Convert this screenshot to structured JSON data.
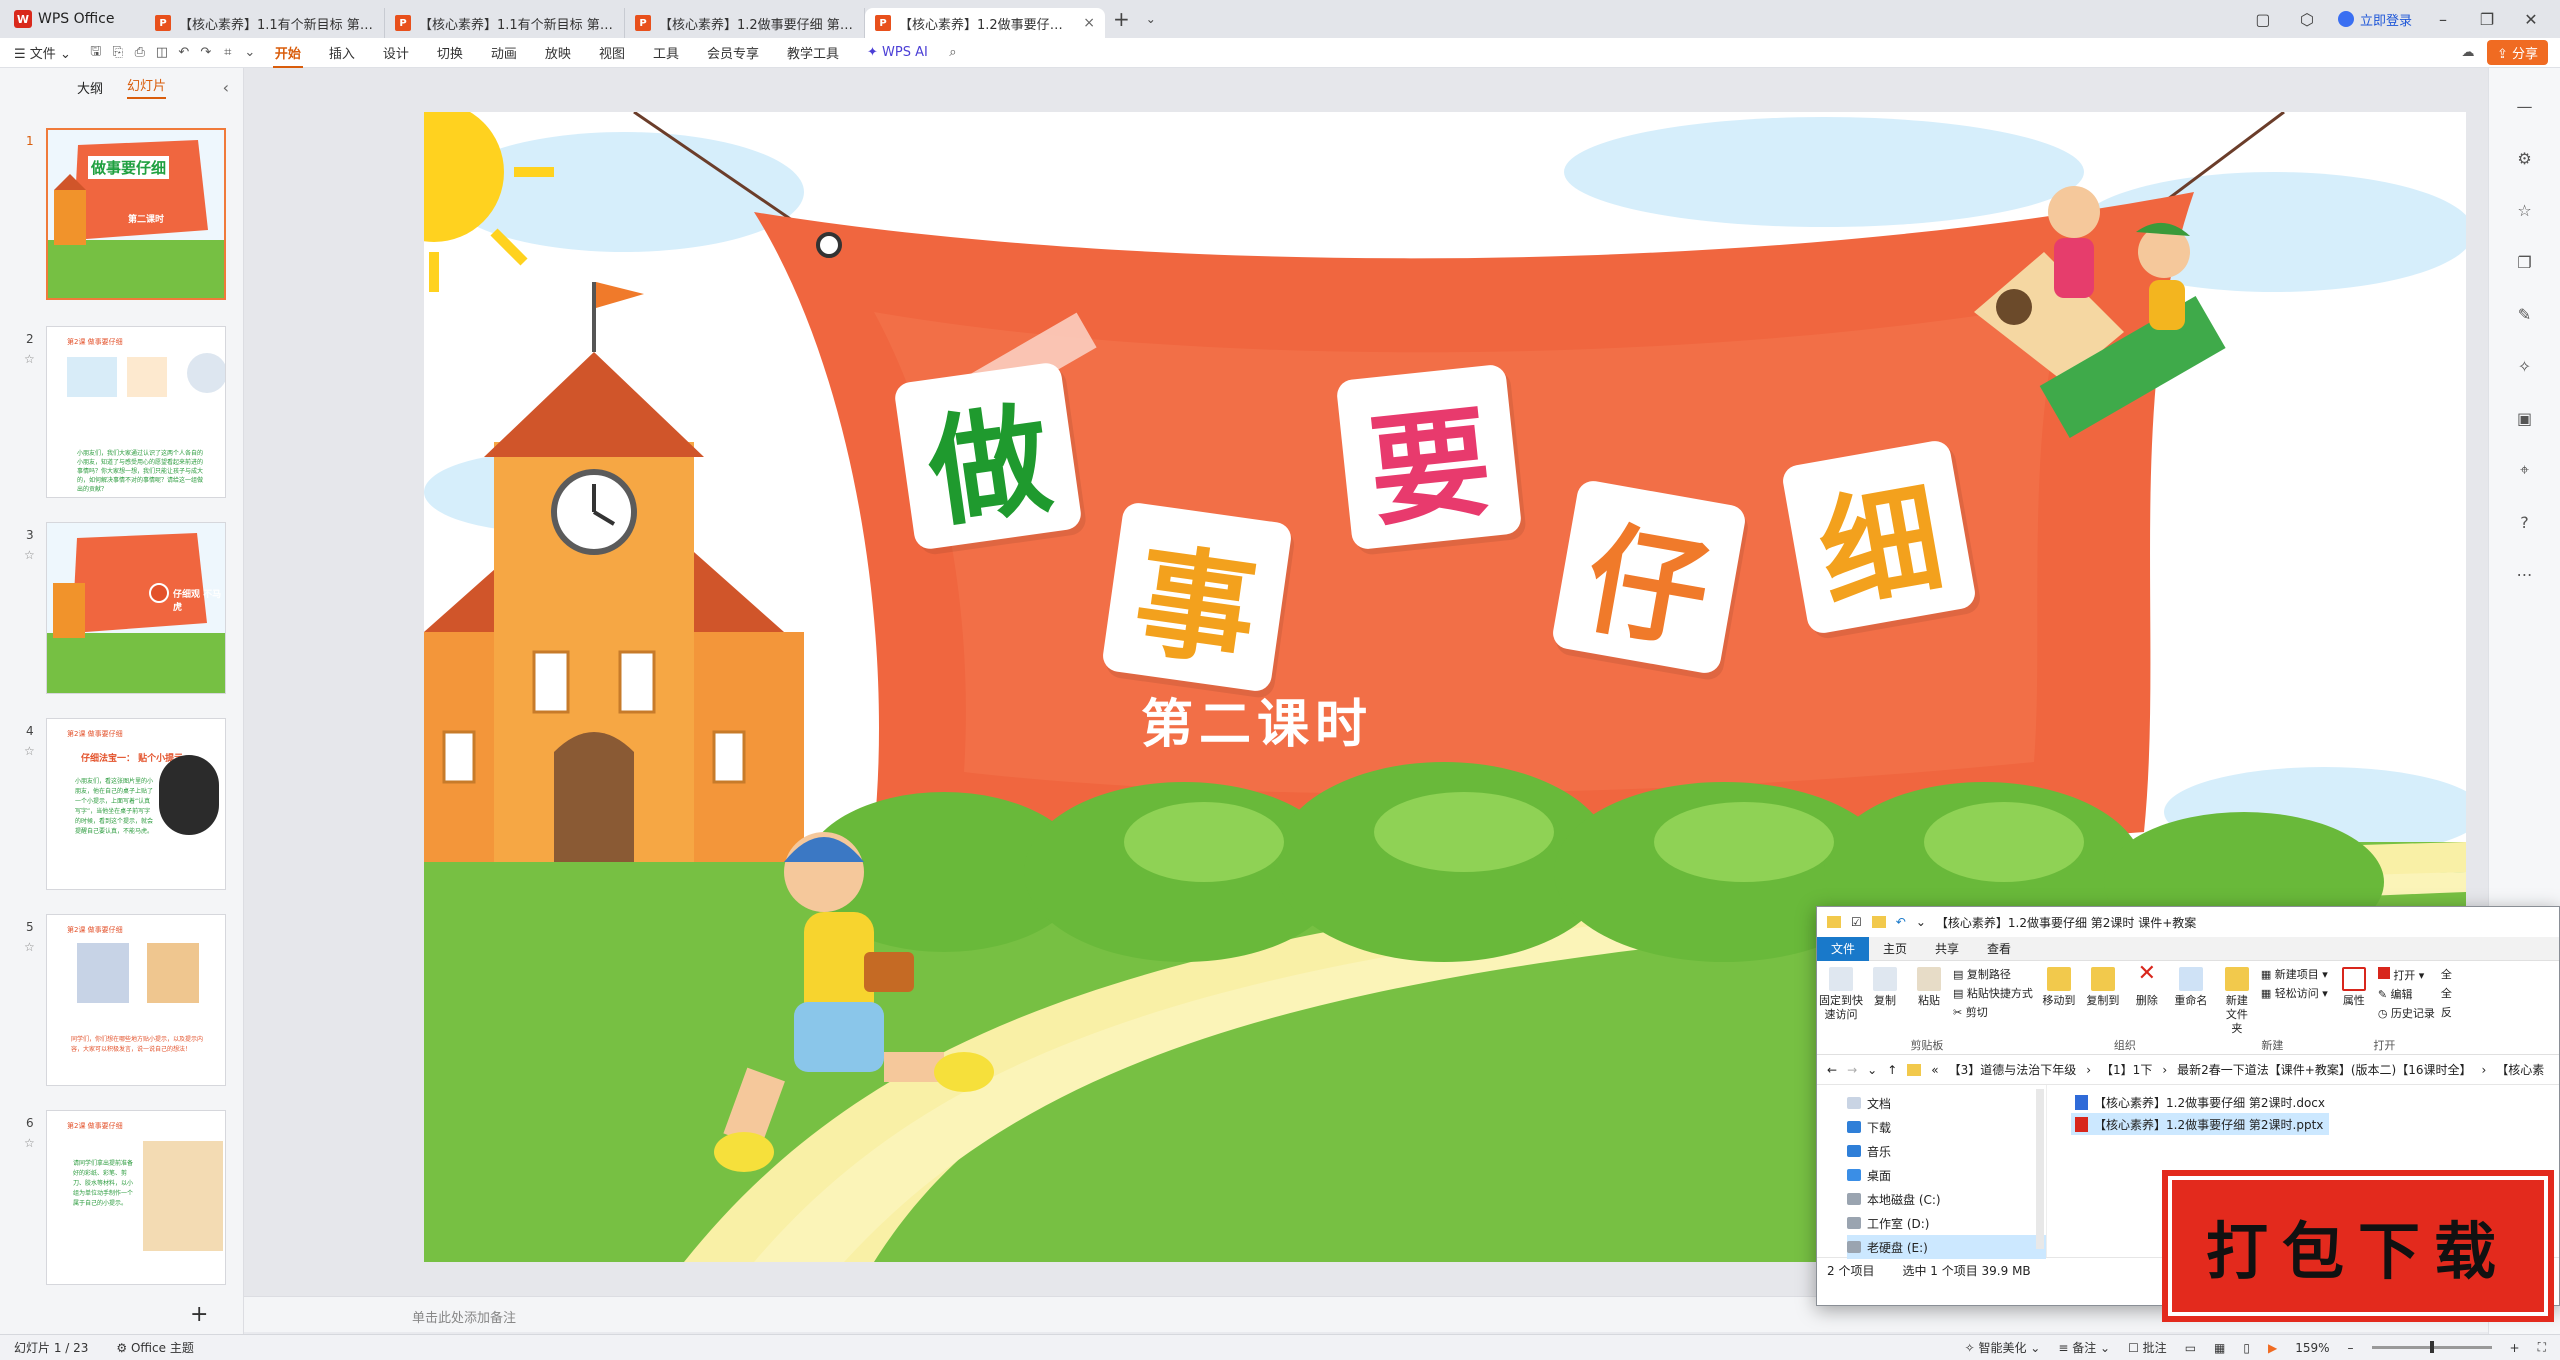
{
  "app": {
    "name": "WPS Office"
  },
  "tabs": [
    {
      "label": "【核心素养】1.1有个新目标 第1课时",
      "icon": "P"
    },
    {
      "label": "【核心素养】1.1有个新目标 第2课时",
      "icon": "P"
    },
    {
      "label": "【核心素养】1.2做事要仔细 第1课时",
      "icon": "P"
    },
    {
      "label": "【核心素养】1.2做事要仔细 第2课时",
      "icon": "P"
    }
  ],
  "header": {
    "login": "立即登录",
    "share": "分享"
  },
  "menu": {
    "file": "文件",
    "items": [
      "开始",
      "插入",
      "设计",
      "切换",
      "动画",
      "放映",
      "视图",
      "工具",
      "会员专享",
      "教学工具"
    ],
    "ai": "WPS AI",
    "active": "开始"
  },
  "left_panel": {
    "tab_outline": "大纲",
    "tab_slides": "幻灯片",
    "slides": [
      {
        "num": "1",
        "title": "做事要仔细",
        "sub": "第二课时"
      },
      {
        "num": "2",
        "header": "第2课 做事要仔细",
        "text": "小朋友们，我们大家通过认识了这两个人各自的小朋友，知道了与感受用心的愿望看起来前进的事情吗？你大家想一想，我们只能让孩子与成大的，如何解决事情不对的事情呢？请给这一组做出的贡献？"
      },
      {
        "num": "3",
        "banner": "仔细观 不马虎"
      },
      {
        "num": "4",
        "header": "第2课 做事要仔细",
        "title": "仔细法宝一： 贴个小提示",
        "text": "小朋友们，看这张图片里的小朋友，他在自己的桌子上贴了一个小提示，上面写着“认真写字”，当他坐在桌子前写字的时候，看到这个提示，就会提醒自己要认真，不能马虎。"
      },
      {
        "num": "5",
        "header": "第2课 做事要仔细",
        "text": "同学们，你们想在哪些地方贴小提示，以及提示内容，大家可以积极发言，说一说自己的想法！"
      },
      {
        "num": "6",
        "header": "第2课 做事要仔细",
        "text": "请同学们拿出提前准备好的彩纸、彩笔、剪刀、胶水等材料，以小组为单位动手制作一个属于自己的小提示。"
      }
    ]
  },
  "slide": {
    "chars": [
      "做",
      "事",
      "要",
      "仔",
      "细"
    ],
    "subtitle": "第二课时"
  },
  "notes": {
    "placeholder": "单击此处添加备注"
  },
  "status": {
    "slide_count": "幻灯片 1 / 23",
    "theme": "Office 主题",
    "beautify": "智能美化",
    "notes": "备注",
    "comments": "批注",
    "zoom": "159%"
  },
  "explorer": {
    "title": "【核心素养】1.2做事要仔细 第2课时 课件+教案",
    "tabs": [
      "文件",
      "主页",
      "共享",
      "查看"
    ],
    "ribbon": {
      "clipboard": {
        "label": "剪贴板",
        "pin": "固定到快速访问",
        "copy": "复制",
        "paste": "粘贴",
        "copy_path": "复制路径",
        "paste_shortcut": "粘贴快捷方式",
        "cut": "剪切"
      },
      "organize": {
        "label": "组织",
        "move_to": "移动到",
        "copy_to": "复制到",
        "delete": "删除",
        "rename": "重命名"
      },
      "new": {
        "label": "新建",
        "new_folder": "新建文件夹",
        "new_item": "新建项目",
        "easy_access": "轻松访问"
      },
      "open": {
        "label": "打开",
        "properties": "属性",
        "open": "打开",
        "edit": "编辑",
        "history": "历史记录"
      },
      "select": {
        "all": "全",
        "none": "全",
        "invert": "反"
      }
    },
    "address": [
      "【3】道德与法治下年级",
      "【1】1下",
      "最新2春一下道法【课件+教案】(版本二)【16课时全】",
      "【核心素"
    ],
    "nav": [
      "文档",
      "下载",
      "音乐",
      "桌面",
      "本地磁盘 (C:)",
      "工作室 (D:)",
      "老硬盘 (E:)"
    ],
    "files": [
      {
        "name": "【核心素养】1.2做事要仔细 第2课时.docx",
        "type": "docx",
        "selected": false
      },
      {
        "name": "【核心素养】1.2做事要仔细 第2课时.pptx",
        "type": "pptx",
        "selected": true
      }
    ],
    "status": {
      "count": "2 个项目",
      "selected": "选中 1 个项目  39.9 MB"
    }
  },
  "stamp": {
    "text": "打包下载"
  }
}
